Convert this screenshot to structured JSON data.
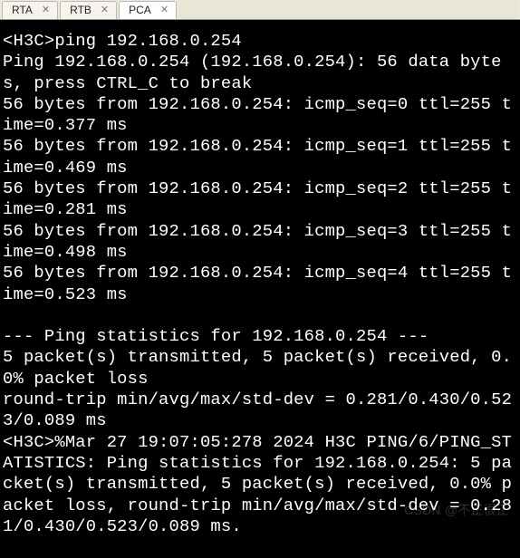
{
  "tabs": [
    {
      "label": "RTA"
    },
    {
      "label": "RTB"
    },
    {
      "label": "PCA"
    }
  ],
  "active_tab_index": 2,
  "terminal": {
    "prompt1": "<H3C>",
    "command": "ping 192.168.0.254",
    "header": "Ping 192.168.0.254 (192.168.0.254): 56 data bytes, press CTRL_C to break",
    "replies": [
      "56 bytes from 192.168.0.254: icmp_seq=0 ttl=255 time=0.377 ms",
      "56 bytes from 192.168.0.254: icmp_seq=1 ttl=255 time=0.469 ms",
      "56 bytes from 192.168.0.254: icmp_seq=2 ttl=255 time=0.281 ms",
      "56 bytes from 192.168.0.254: icmp_seq=3 ttl=255 time=0.498 ms",
      "56 bytes from 192.168.0.254: icmp_seq=4 ttl=255 time=0.523 ms"
    ],
    "blank": "",
    "stats_header": "--- Ping statistics for 192.168.0.254 ---",
    "stats_line1": "5 packet(s) transmitted, 5 packet(s) received, 0.0% packet loss",
    "stats_line2": "round-trip min/avg/max/std-dev = 0.281/0.430/0.523/0.089 ms",
    "log_line": "<H3C>%Mar 27 19:07:05:278 2024 H3C PING/6/PING_STATISTICS: Ping statistics for 192.168.0.254: 5 packet(s) transmitted, 5 packet(s) received, 0.0% packet loss, round-trip min/avg/max/std-dev = 0.281/0.430/0.523/0.089 ms."
  },
  "watermark": "CSDN @不正很正"
}
